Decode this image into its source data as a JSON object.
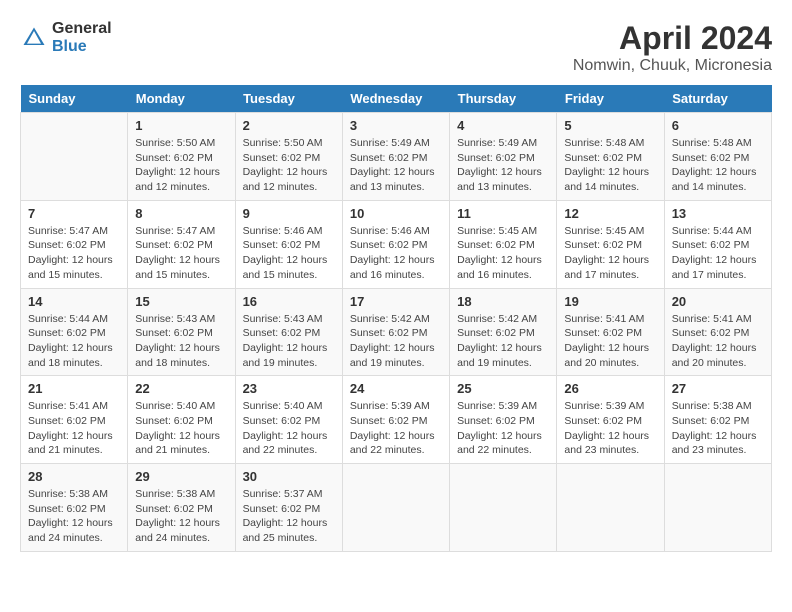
{
  "logo": {
    "general": "General",
    "blue": "Blue"
  },
  "title": "April 2024",
  "subtitle": "Nomwin, Chuuk, Micronesia",
  "days_header": [
    "Sunday",
    "Monday",
    "Tuesday",
    "Wednesday",
    "Thursday",
    "Friday",
    "Saturday"
  ],
  "weeks": [
    [
      {
        "day": "",
        "info": ""
      },
      {
        "day": "1",
        "info": "Sunrise: 5:50 AM\nSunset: 6:02 PM\nDaylight: 12 hours\nand 12 minutes."
      },
      {
        "day": "2",
        "info": "Sunrise: 5:50 AM\nSunset: 6:02 PM\nDaylight: 12 hours\nand 12 minutes."
      },
      {
        "day": "3",
        "info": "Sunrise: 5:49 AM\nSunset: 6:02 PM\nDaylight: 12 hours\nand 13 minutes."
      },
      {
        "day": "4",
        "info": "Sunrise: 5:49 AM\nSunset: 6:02 PM\nDaylight: 12 hours\nand 13 minutes."
      },
      {
        "day": "5",
        "info": "Sunrise: 5:48 AM\nSunset: 6:02 PM\nDaylight: 12 hours\nand 14 minutes."
      },
      {
        "day": "6",
        "info": "Sunrise: 5:48 AM\nSunset: 6:02 PM\nDaylight: 12 hours\nand 14 minutes."
      }
    ],
    [
      {
        "day": "7",
        "info": "Sunrise: 5:47 AM\nSunset: 6:02 PM\nDaylight: 12 hours\nand 15 minutes."
      },
      {
        "day": "8",
        "info": "Sunrise: 5:47 AM\nSunset: 6:02 PM\nDaylight: 12 hours\nand 15 minutes."
      },
      {
        "day": "9",
        "info": "Sunrise: 5:46 AM\nSunset: 6:02 PM\nDaylight: 12 hours\nand 15 minutes."
      },
      {
        "day": "10",
        "info": "Sunrise: 5:46 AM\nSunset: 6:02 PM\nDaylight: 12 hours\nand 16 minutes."
      },
      {
        "day": "11",
        "info": "Sunrise: 5:45 AM\nSunset: 6:02 PM\nDaylight: 12 hours\nand 16 minutes."
      },
      {
        "day": "12",
        "info": "Sunrise: 5:45 AM\nSunset: 6:02 PM\nDaylight: 12 hours\nand 17 minutes."
      },
      {
        "day": "13",
        "info": "Sunrise: 5:44 AM\nSunset: 6:02 PM\nDaylight: 12 hours\nand 17 minutes."
      }
    ],
    [
      {
        "day": "14",
        "info": "Sunrise: 5:44 AM\nSunset: 6:02 PM\nDaylight: 12 hours\nand 18 minutes."
      },
      {
        "day": "15",
        "info": "Sunrise: 5:43 AM\nSunset: 6:02 PM\nDaylight: 12 hours\nand 18 minutes."
      },
      {
        "day": "16",
        "info": "Sunrise: 5:43 AM\nSunset: 6:02 PM\nDaylight: 12 hours\nand 19 minutes."
      },
      {
        "day": "17",
        "info": "Sunrise: 5:42 AM\nSunset: 6:02 PM\nDaylight: 12 hours\nand 19 minutes."
      },
      {
        "day": "18",
        "info": "Sunrise: 5:42 AM\nSunset: 6:02 PM\nDaylight: 12 hours\nand 19 minutes."
      },
      {
        "day": "19",
        "info": "Sunrise: 5:41 AM\nSunset: 6:02 PM\nDaylight: 12 hours\nand 20 minutes."
      },
      {
        "day": "20",
        "info": "Sunrise: 5:41 AM\nSunset: 6:02 PM\nDaylight: 12 hours\nand 20 minutes."
      }
    ],
    [
      {
        "day": "21",
        "info": "Sunrise: 5:41 AM\nSunset: 6:02 PM\nDaylight: 12 hours\nand 21 minutes."
      },
      {
        "day": "22",
        "info": "Sunrise: 5:40 AM\nSunset: 6:02 PM\nDaylight: 12 hours\nand 21 minutes."
      },
      {
        "day": "23",
        "info": "Sunrise: 5:40 AM\nSunset: 6:02 PM\nDaylight: 12 hours\nand 22 minutes."
      },
      {
        "day": "24",
        "info": "Sunrise: 5:39 AM\nSunset: 6:02 PM\nDaylight: 12 hours\nand 22 minutes."
      },
      {
        "day": "25",
        "info": "Sunrise: 5:39 AM\nSunset: 6:02 PM\nDaylight: 12 hours\nand 22 minutes."
      },
      {
        "day": "26",
        "info": "Sunrise: 5:39 AM\nSunset: 6:02 PM\nDaylight: 12 hours\nand 23 minutes."
      },
      {
        "day": "27",
        "info": "Sunrise: 5:38 AM\nSunset: 6:02 PM\nDaylight: 12 hours\nand 23 minutes."
      }
    ],
    [
      {
        "day": "28",
        "info": "Sunrise: 5:38 AM\nSunset: 6:02 PM\nDaylight: 12 hours\nand 24 minutes."
      },
      {
        "day": "29",
        "info": "Sunrise: 5:38 AM\nSunset: 6:02 PM\nDaylight: 12 hours\nand 24 minutes."
      },
      {
        "day": "30",
        "info": "Sunrise: 5:37 AM\nSunset: 6:02 PM\nDaylight: 12 hours\nand 25 minutes."
      },
      {
        "day": "",
        "info": ""
      },
      {
        "day": "",
        "info": ""
      },
      {
        "day": "",
        "info": ""
      },
      {
        "day": "",
        "info": ""
      }
    ]
  ]
}
